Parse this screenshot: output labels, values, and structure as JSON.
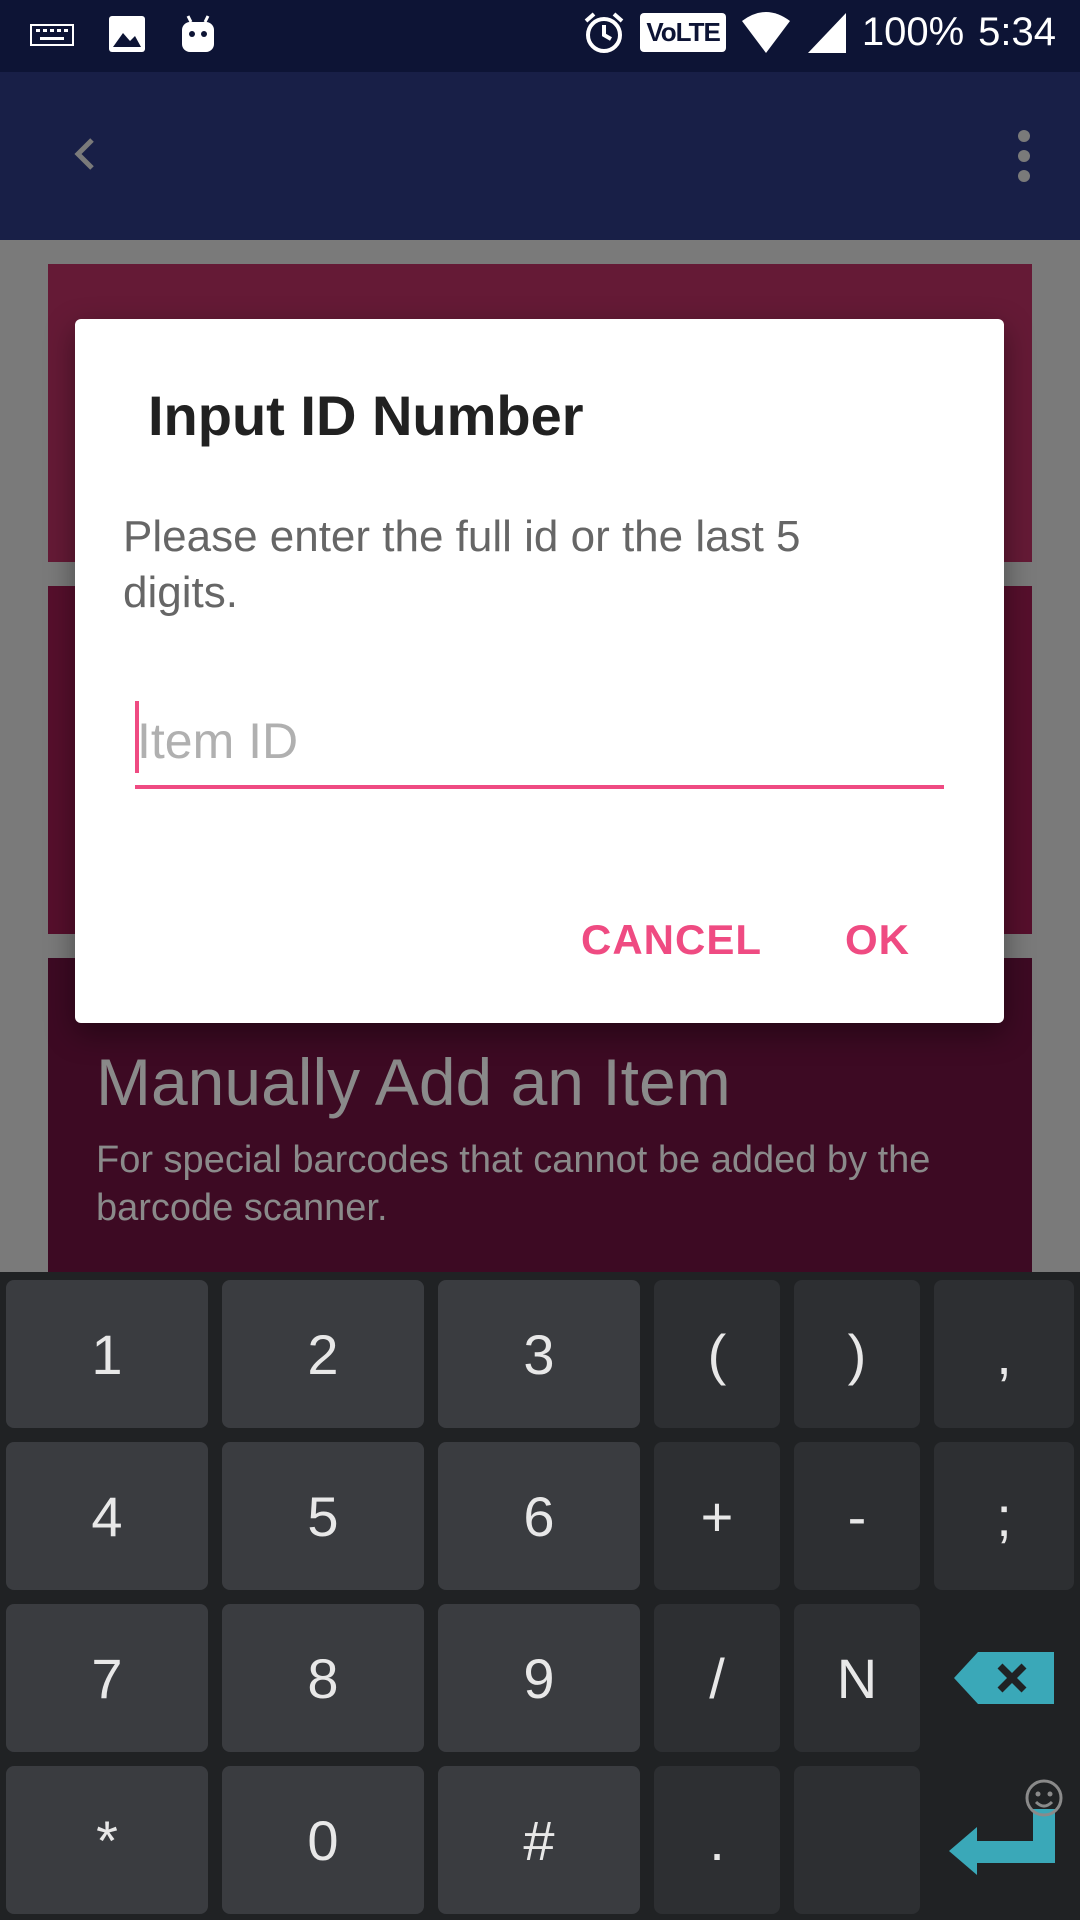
{
  "status_bar": {
    "battery": "100%",
    "time": "5:34",
    "network_badge": "VoLTE",
    "icons": [
      "keyboard-icon",
      "image-icon",
      "android-icon",
      "alarm-icon",
      "wifi-icon",
      "signal-icon"
    ]
  },
  "background": {
    "card3_title": "Manually Add an Item",
    "card3_subtitle": "For special barcodes that cannot be added by the barcode scanner."
  },
  "dialog": {
    "title": "Input ID Number",
    "message": "Please enter the full id or the last 5 digits.",
    "input_placeholder": "Item ID",
    "input_value": "",
    "cancel_label": "CANCEL",
    "ok_label": "OK",
    "accent_color": "#ef4b82"
  },
  "keyboard": {
    "row1": [
      "1",
      "2",
      "3",
      "(",
      ")",
      ","
    ],
    "row2": [
      "4",
      "5",
      "6",
      "+",
      "-",
      ";"
    ],
    "row3": [
      "7",
      "8",
      "9",
      "/",
      "N"
    ],
    "row4": [
      "*",
      "0",
      "#",
      "."
    ],
    "accent_color": "#3aa8b8"
  }
}
